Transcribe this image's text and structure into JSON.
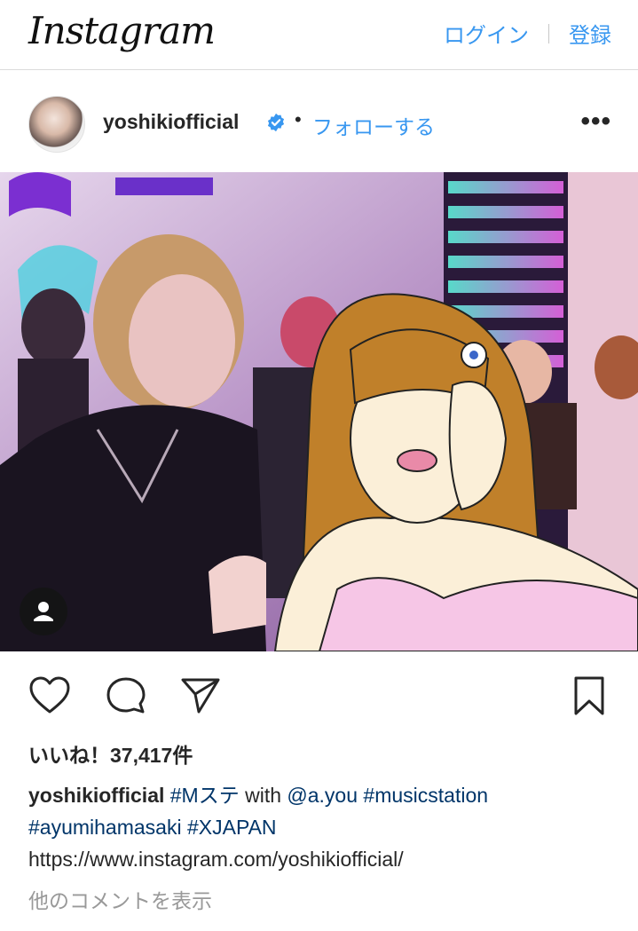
{
  "header": {
    "logo_text": "Instagram",
    "login_label": "ログイン",
    "signup_label": "登録"
  },
  "post": {
    "username": "yoshikiofficial",
    "separator": "•",
    "follow_label": "フォローする",
    "more_label": "•••"
  },
  "stats": {
    "likes_text": "いいね！37,417件"
  },
  "caption": {
    "username": "yoshikiofficial",
    "tag1": "#Mステ",
    "with_word": "with",
    "mention": "@a.you",
    "tag2": "#musicstation",
    "tag3": "#ayumihamasaki",
    "tag4": "#XJAPAN",
    "url": "https://www.instagram.com/yoshikiofficial/"
  },
  "footer": {
    "view_comments": "他のコメントを表示"
  },
  "icons": {
    "like": "heart-icon",
    "comment": "comment-icon",
    "share": "paper-plane-icon",
    "save": "bookmark-icon",
    "verified": "verified-badge-icon",
    "tagged_user": "user-icon"
  },
  "colors": {
    "link_blue": "#3897f0",
    "hashtag_navy": "#003569",
    "muted_gray": "#999999",
    "verified_blue": "#3897f0"
  }
}
